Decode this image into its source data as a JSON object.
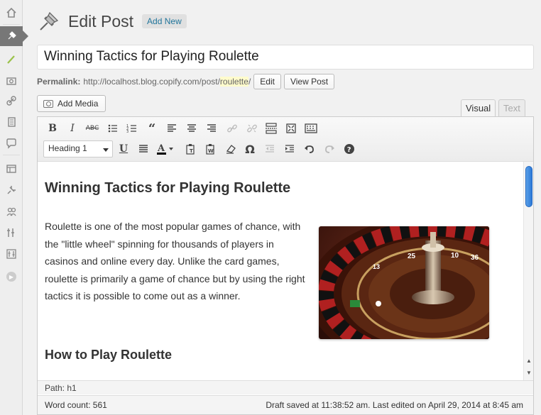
{
  "header": {
    "title": "Edit Post",
    "add_new_label": "Add New"
  },
  "post": {
    "title": "Winning Tactics for Playing Roulette"
  },
  "permalink": {
    "label": "Permalink:",
    "base_url": "http://localhost.blog.copify.com/post/",
    "slug": "roulette",
    "trailing": "/",
    "edit_label": "Edit",
    "view_label": "View Post"
  },
  "media": {
    "add_media_label": "Add Media"
  },
  "tabs": {
    "visual": "Visual",
    "text": "Text"
  },
  "toolbar": {
    "format_value": "Heading 1",
    "icons": [
      "bold-icon",
      "italic-icon",
      "strikethrough-icon",
      "bullet-list-icon",
      "numbered-list-icon",
      "blockquote-icon",
      "align-left-icon",
      "align-center-icon",
      "align-right-icon",
      "insert-link-icon",
      "remove-link-icon",
      "read-more-icon",
      "fullscreen-icon",
      "toolbar-toggle-icon",
      "underline-icon",
      "justify-icon",
      "text-color-icon",
      "paste-text-icon",
      "paste-word-icon",
      "clear-formatting-icon",
      "special-character-icon",
      "outdent-icon",
      "indent-icon",
      "undo-icon",
      "redo-icon",
      "help-icon"
    ]
  },
  "content": {
    "heading": "Winning Tactics for Playing Roulette",
    "paragraph": "Roulette is one of the most popular games of chance, with the \"little wheel\" spinning for thousands of players in casinos and online every day. Unlike the card games, roulette is primarily a game of chance but by using the right tactics it is possible to come out as a winner.",
    "subheading": "How to Play Roulette",
    "wheel_numbers": [
      "25",
      "10",
      "13",
      "36"
    ]
  },
  "status": {
    "path": "Path: h1",
    "word_count": "Word count: 561",
    "draft_saved": "Draft saved at 11:38:52 am. Last edited on April 29, 2014 at 8:45 am"
  },
  "colors": {
    "link_blue": "#21759b",
    "slug_highlight": "#fffbcc",
    "scroll_thumb": "#2d7ad8",
    "active_menu": "#777777"
  }
}
